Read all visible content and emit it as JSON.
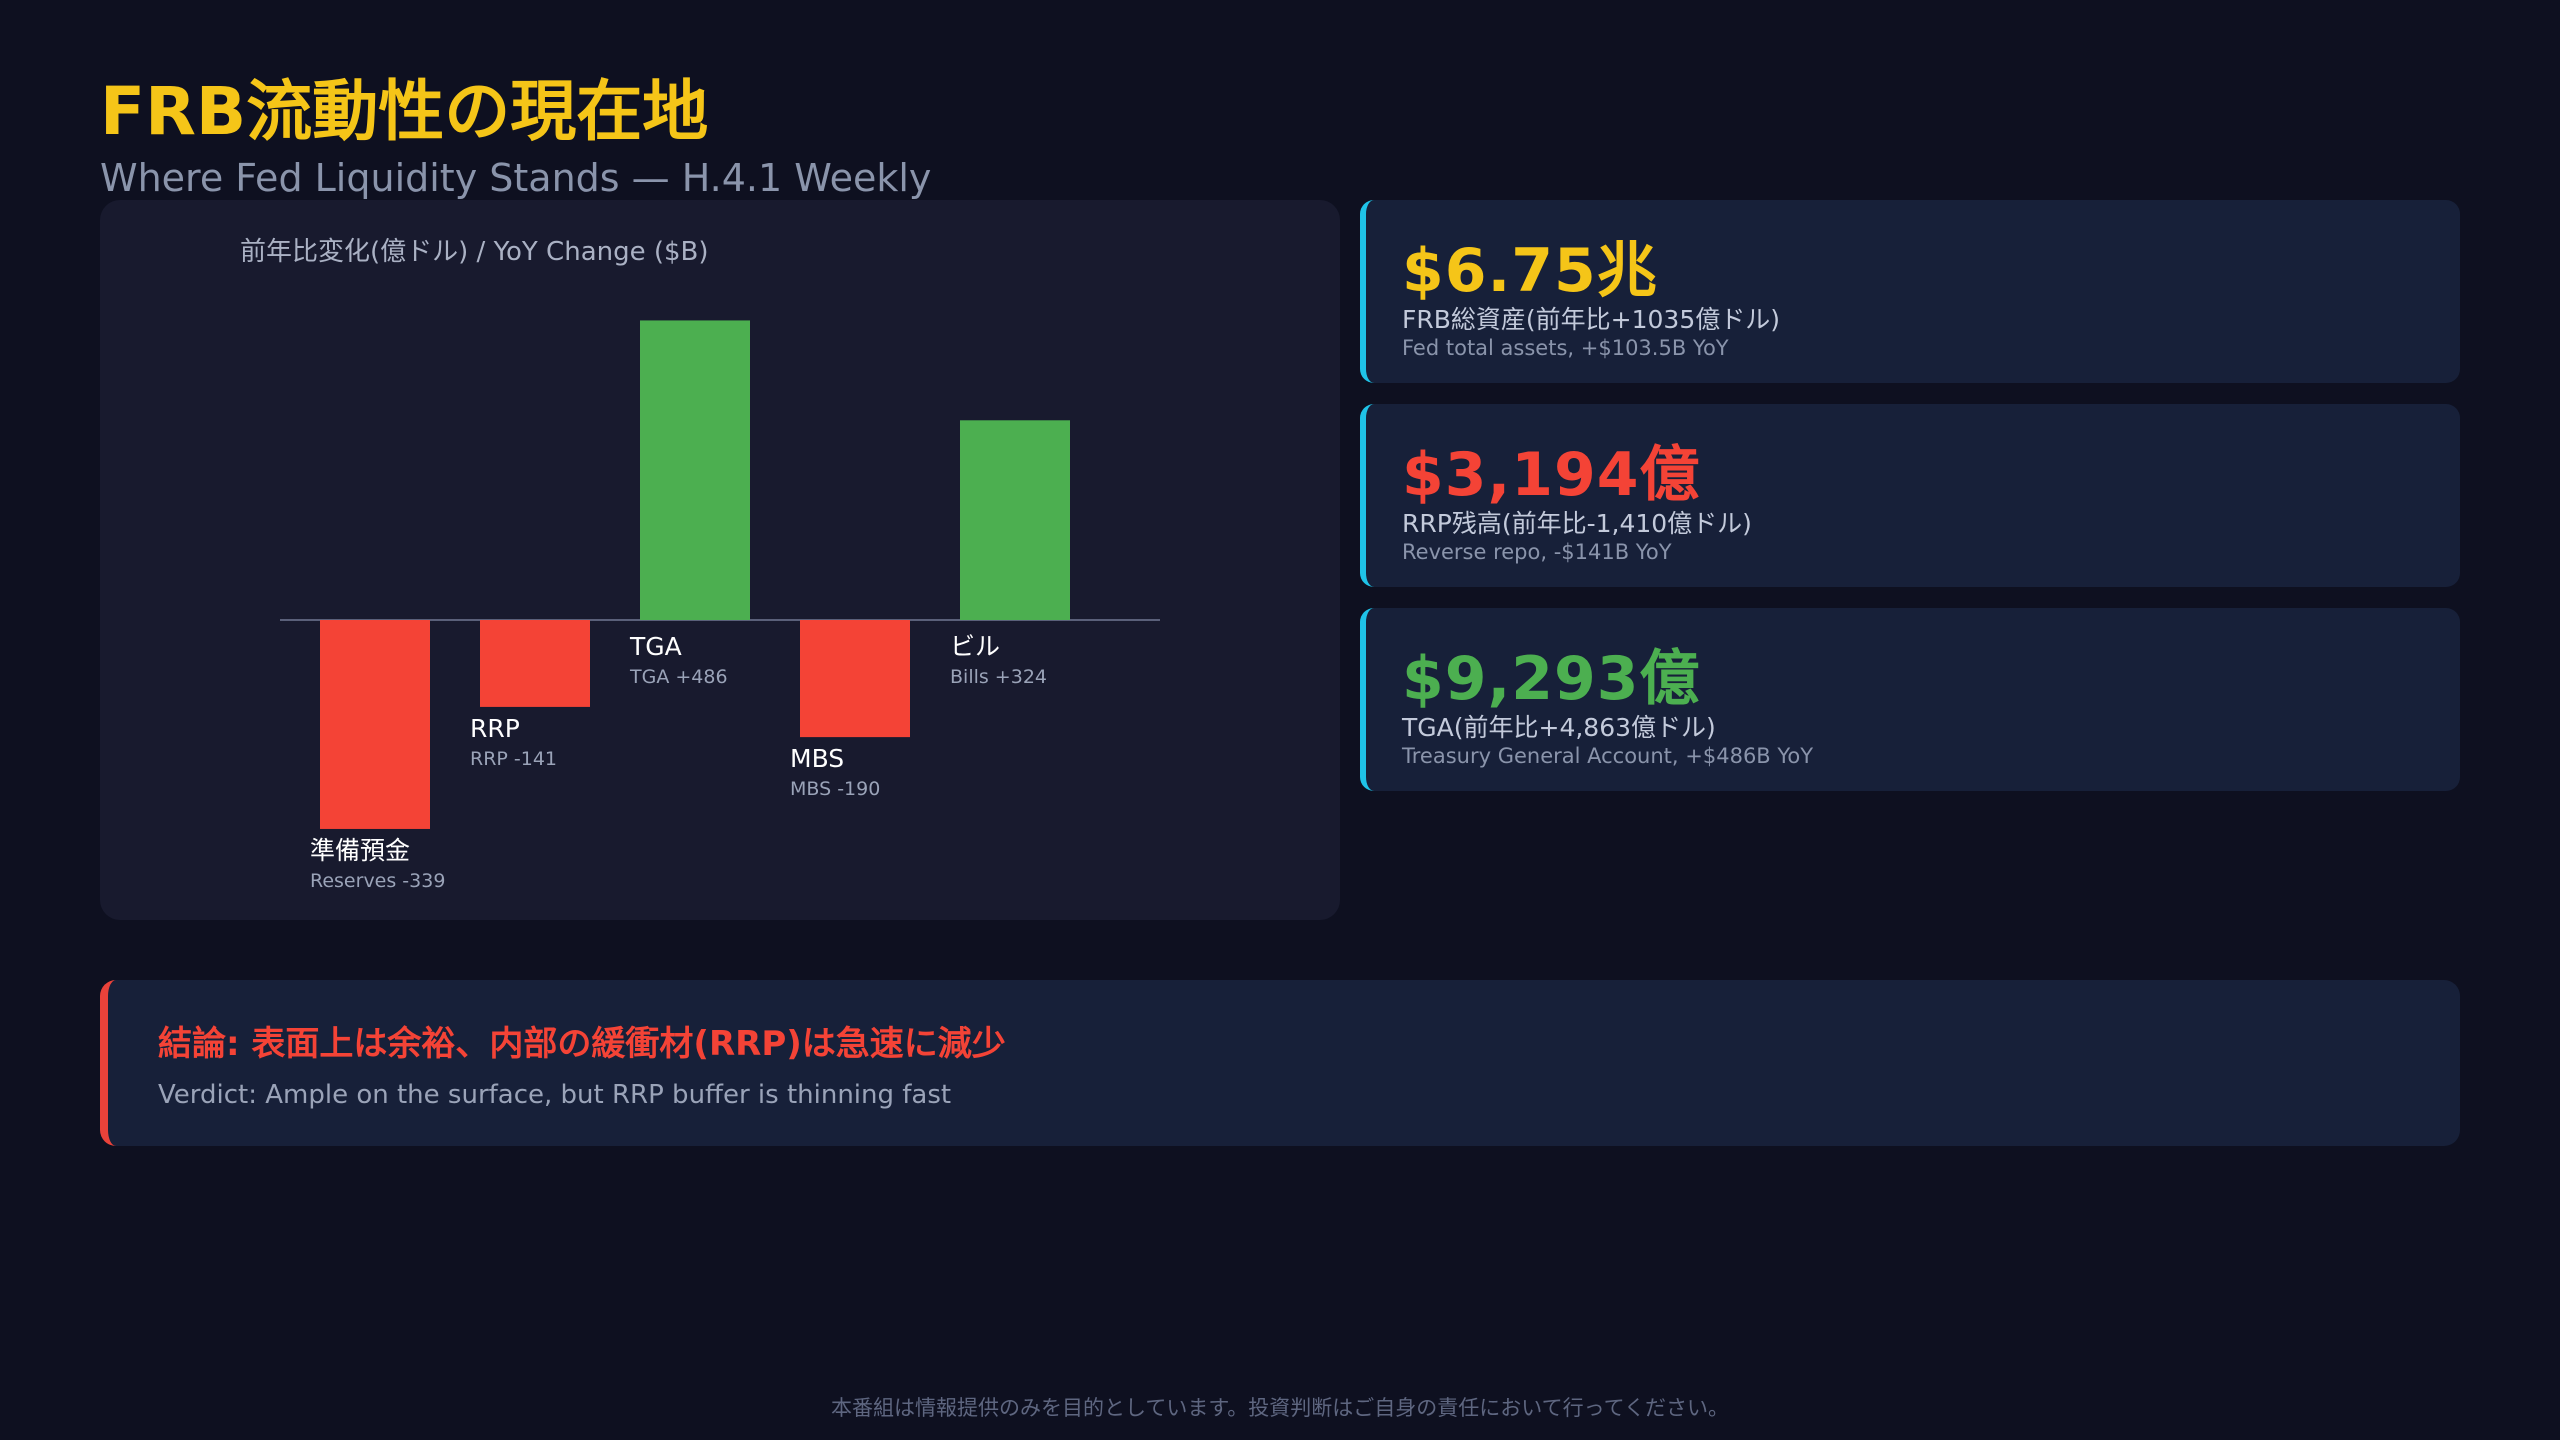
{
  "header": {
    "title": "FRB流動性の現在地",
    "subtitle": "Where Fed Liquidity Stands — H.4.1 Weekly"
  },
  "colors": {
    "positive": "#4caf50",
    "negative": "#f44336",
    "accent_title": "#f5c518",
    "card_border": "#1fc3e8"
  },
  "chart_data": {
    "type": "bar",
    "title": "前年比変化(億ドル) / YoY Change ($B)",
    "categories": [
      "準備預金",
      "RRP",
      "TGA",
      "MBS",
      "ビル"
    ],
    "category_sublabels": [
      "Reserves -339",
      "RRP -141",
      "TGA +486",
      "MBS -190",
      "Bills +324"
    ],
    "values": [
      -339,
      -141,
      486,
      -190,
      324
    ],
    "ylim": [
      -339,
      486
    ],
    "grid": false
  },
  "cards": [
    {
      "value": "$6.75兆",
      "label_jp": "FRB総資産(前年比+1035億ドル)",
      "label_en": "Fed total assets, +$103.5B YoY",
      "color": "#f5c518"
    },
    {
      "value": "$3,194億",
      "label_jp": "RRP残高(前年比-1,410億ドル)",
      "label_en": "Reverse repo, -$141B YoY",
      "color": "#f44336"
    },
    {
      "value": "$9,293億",
      "label_jp": "TGA(前年比+4,863億ドル)",
      "label_en": "Treasury General Account, +$486B YoY",
      "color": "#4caf50"
    }
  ],
  "verdict": {
    "jp": "結論: 表面上は余裕、内部の緩衝材(RRP)は急速に減少",
    "en": "Verdict: Ample on the surface, but RRP buffer is thinning fast"
  },
  "footer": {
    "disclaimer": "本番組は情報提供のみを目的としています。投資判断はご自身の責任において行ってください。"
  }
}
